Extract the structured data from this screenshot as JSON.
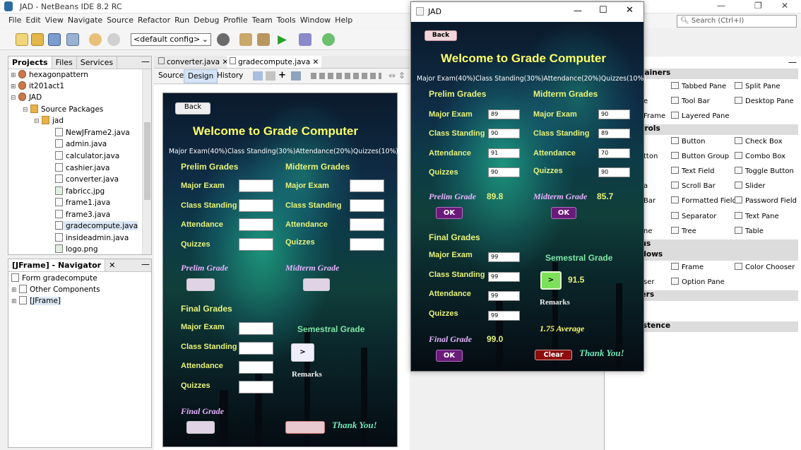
{
  "window": {
    "title": "JAD - NetBeans IDE 8.2 RC",
    "search_placeholder": "Search (Ctrl+I)",
    "min": "—",
    "max": "❐",
    "close": "✕"
  },
  "menu": [
    "File",
    "Edit",
    "View",
    "Navigate",
    "Source",
    "Refactor",
    "Run",
    "Debug",
    "Profile",
    "Team",
    "Tools",
    "Window",
    "Help"
  ],
  "toolbar": {
    "config": "<default config>"
  },
  "projects": {
    "tabs": [
      "Projects",
      "Files",
      "Services"
    ],
    "nodes": [
      "hexagonpattern",
      "it201act1",
      "JAD",
      "Source Packages",
      "jad",
      "NewJFrame2.java",
      "admin.java",
      "calculator.java",
      "cashier.java",
      "converter.java",
      "fabricc.jpg",
      "frame1.java",
      "frame3.java",
      "gradecompute.java",
      "insideadmin.java",
      "logo.png"
    ]
  },
  "navigator": {
    "title": "[JFrame] - Navigator",
    "nodes": [
      "Form gradecompute",
      "Other Components",
      "[JFrame]"
    ]
  },
  "editor": {
    "tabs": [
      "converter.java",
      "gradecompute.java"
    ],
    "modes": [
      "Source",
      "Design",
      "History"
    ]
  },
  "app": {
    "back": "Back",
    "welcome": "Welcome to Grade Computer",
    "weights": "Major Exam(40%)Class Standing(30%)Attendance(20%)Quizzes(10%)",
    "prelim_header": "Prelim Grades",
    "midterm_header": "Midterm Grades",
    "final_header": "Final Grades",
    "labels": {
      "major": "Major Exam",
      "class": "Class Standing",
      "att": "Attendance",
      "quiz": "Quizzes"
    },
    "prelim_grade_label": "Prelim Grade",
    "midterm_grade_label": "Midterm Grade",
    "final_grade_label": "Final Grade",
    "semestral": "Semestral Grade",
    "remarks": "Remarks",
    "ok": "OK",
    "go": ">",
    "clear": "Clear",
    "thanks": "Thank You!"
  },
  "runtime": {
    "title": "JAD",
    "prelim": {
      "major": "89",
      "class": "90",
      "att": "91",
      "quiz": "90",
      "grade": "89.8"
    },
    "midterm": {
      "major": "90",
      "class": "89",
      "att": "70",
      "quiz": "90",
      "grade": "85.7"
    },
    "final": {
      "major": "99",
      "class": "99",
      "att": "99",
      "quiz": "99",
      "grade": "99.0"
    },
    "semestral": "91.5",
    "remarks_value": "1.75 Average"
  },
  "palette": {
    "sections": [
      "ntainers",
      "ntrols",
      "nus",
      "ndows",
      "ders",
      "sistence"
    ],
    "containers": [
      [
        "Tabbed Pane",
        "Split Pane"
      ],
      [
        "Tool Bar",
        "Desktop Pane"
      ],
      [
        "Layered Pane",
        ""
      ]
    ],
    "controls": [
      [
        "Button",
        "Check Box"
      ],
      [
        "Button Group",
        "Combo Box"
      ],
      [
        "Text Field",
        "Toggle Button"
      ],
      [
        "Scroll Bar",
        "Slider"
      ],
      [
        "Formatted Field",
        "Password Field"
      ],
      [
        "Separator",
        "Text Pane"
      ],
      [
        "Tree",
        "Table"
      ]
    ],
    "windows": [
      [
        "Frame",
        "Color Chooser"
      ],
      [
        "Option Pane",
        ""
      ]
    ],
    "left_frags": [
      "e",
      "Frame",
      "tton",
      "a",
      "Bar",
      "ne",
      "ser"
    ]
  }
}
